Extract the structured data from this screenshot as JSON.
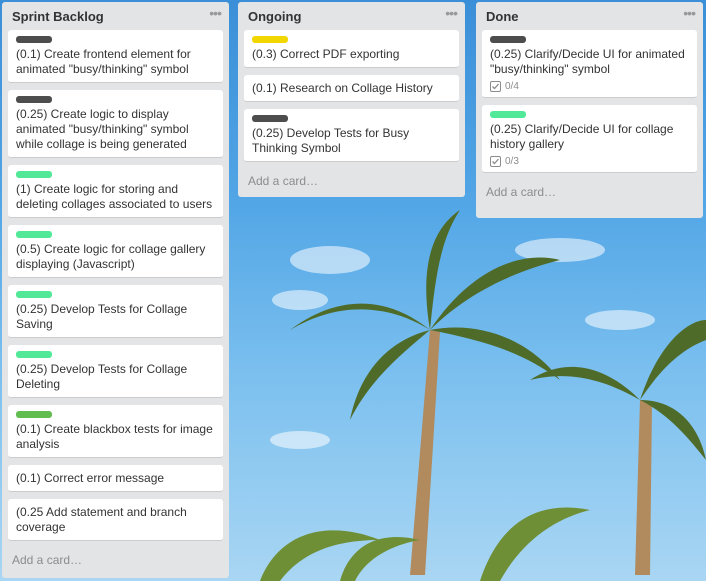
{
  "colors": {
    "label_dark": "#4d4d4d",
    "label_green": "#51e898",
    "label_green_dark": "#61bd4f",
    "label_yellow": "#f2d600"
  },
  "lists": [
    {
      "title": "Sprint Backlog",
      "menu_icon": "ellipsis-icon",
      "add_card": "Add a card…",
      "cards": [
        {
          "label": "#4d4d4d",
          "title": "(0.1) Create frontend element for animated \"busy/thinking\" symbol"
        },
        {
          "label": "#4d4d4d",
          "title": "(0.25) Create logic to display animated \"busy/thinking\" symbol while collage is being generated"
        },
        {
          "label": "#51e898",
          "title": "(1) Create logic for storing and deleting collages associated to users"
        },
        {
          "label": "#51e898",
          "title": "(0.5) Create logic for collage gallery displaying (Javascript)"
        },
        {
          "label": "#51e898",
          "title": "(0.25) Develop Tests for Collage Saving"
        },
        {
          "label": "#51e898",
          "title": "(0.25) Develop Tests for Collage Deleting"
        },
        {
          "label": "#61bd4f",
          "title": "(0.1) Create blackbox tests for image analysis"
        },
        {
          "label": null,
          "title": "(0.1) Correct error message"
        },
        {
          "label": null,
          "title": "(0.25 Add statement and branch coverage"
        }
      ]
    },
    {
      "title": "Ongoing",
      "menu_icon": "ellipsis-icon",
      "add_card": "Add a card…",
      "cards": [
        {
          "label": "#f2d600",
          "title": "(0.3) Correct PDF exporting"
        },
        {
          "label": null,
          "title": "(0.1) Research on Collage History"
        },
        {
          "label": "#4d4d4d",
          "title": "(0.25) Develop Tests for Busy Thinking Symbol"
        }
      ]
    },
    {
      "title": "Done",
      "menu_icon": "ellipsis-icon",
      "add_card": "Add a card…",
      "cards": [
        {
          "label": "#4d4d4d",
          "title": "(0.25) Clarify/Decide UI for animated \"busy/thinking\" symbol",
          "checklist": "0/4",
          "checklist_icon": "checkbox-icon"
        },
        {
          "label": "#51e898",
          "title": "(0.25) Clarify/Decide UI for collage history gallery",
          "checklist": "0/3",
          "checklist_icon": "checkbox-icon"
        }
      ]
    }
  ]
}
